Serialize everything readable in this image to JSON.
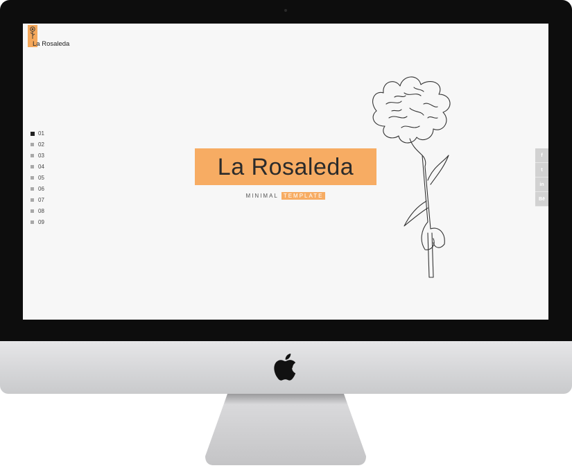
{
  "logo": {
    "text": "La Rosaleda"
  },
  "nav": {
    "items": [
      "01",
      "02",
      "03",
      "04",
      "05",
      "06",
      "07",
      "08",
      "09"
    ],
    "active_index": 0
  },
  "hero": {
    "title": "La Rosaleda",
    "subtitle_plain": "MINIMAL",
    "subtitle_highlight": "TEMPLATE"
  },
  "social": [
    {
      "icon": "facebook-icon",
      "glyph": "f"
    },
    {
      "icon": "twitter-icon",
      "glyph": "t"
    },
    {
      "icon": "linkedin-icon",
      "glyph": "in"
    },
    {
      "icon": "behance-icon",
      "glyph": "Bē"
    }
  ],
  "colors": {
    "accent": "#f7ac63",
    "screen_bg": "#f7f7f7",
    "bezel": "#0d0d0d"
  }
}
